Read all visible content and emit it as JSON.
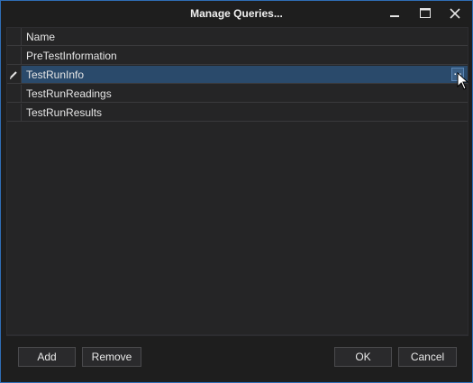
{
  "window": {
    "title": "Manage Queries..."
  },
  "grid": {
    "column_header": "Name",
    "rows": [
      {
        "name": "PreTestInformation",
        "selected": false
      },
      {
        "name": "TestRunInfo",
        "selected": true,
        "editing": true
      },
      {
        "name": "TestRunReadings",
        "selected": false
      },
      {
        "name": "TestRunResults",
        "selected": false
      }
    ],
    "edit_button_label": "..."
  },
  "buttons": {
    "add": "Add",
    "remove": "Remove",
    "ok": "OK",
    "cancel": "Cancel"
  },
  "icons": {
    "edit_row": "pencil-icon",
    "minimize": "minimize-icon",
    "maximize": "maximize-icon",
    "close": "close-icon",
    "cursor": "mouse-pointer-icon"
  },
  "colors": {
    "window_border": "#2f6db5",
    "background": "#1e1e1e",
    "selection": "#2a4a6b"
  }
}
